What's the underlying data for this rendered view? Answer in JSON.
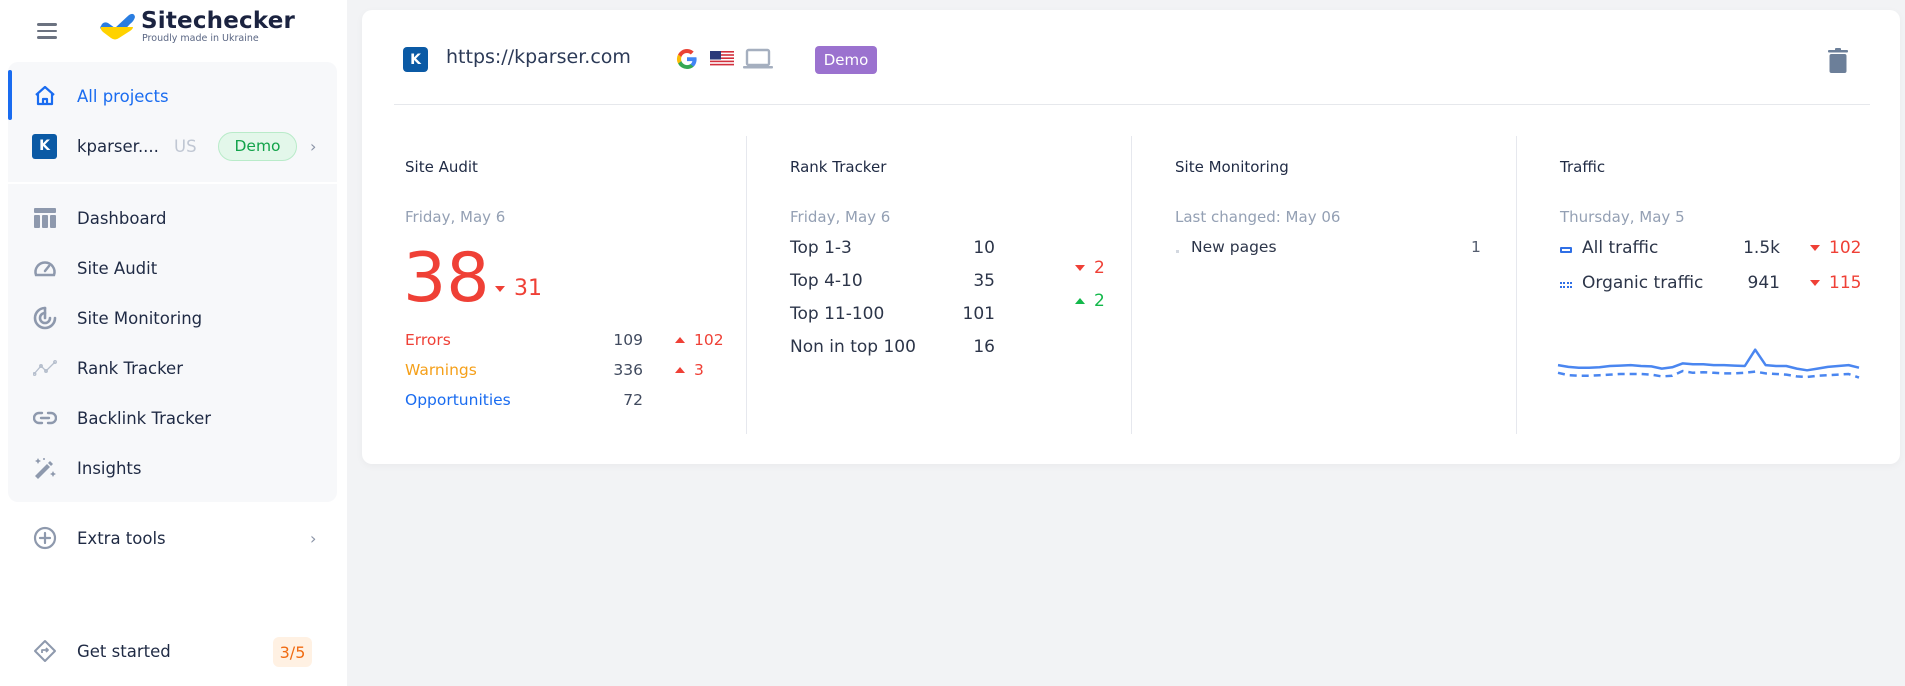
{
  "brand": {
    "name": "Sitechecker",
    "tagline": "Proudly made in Ukraine"
  },
  "sidebar": {
    "all_projects": "All projects",
    "project": {
      "initial": "K",
      "name": "kparser....",
      "country": "US",
      "badge": "Demo"
    },
    "items": [
      {
        "label": "Dashboard",
        "icon": "dashboard-icon"
      },
      {
        "label": "Site Audit",
        "icon": "gauge-icon"
      },
      {
        "label": "Site Monitoring",
        "icon": "radar-icon"
      },
      {
        "label": "Rank Tracker",
        "icon": "trend-line-icon"
      },
      {
        "label": "Backlink Tracker",
        "icon": "link-icon"
      },
      {
        "label": "Insights",
        "icon": "magic-wand-icon"
      }
    ],
    "extra_tools": "Extra tools",
    "get_started": {
      "label": "Get started",
      "progress": "3/5"
    }
  },
  "project_card": {
    "initial": "K",
    "url": "https://kparser.com",
    "search_engine": "Google",
    "country": "US",
    "device": "desktop",
    "badge": "Demo",
    "site_audit": {
      "title": "Site Audit",
      "date": "Friday, May 6",
      "score": "38",
      "score_delta": "31",
      "score_delta_dir": "down",
      "rows": [
        {
          "label": "Errors",
          "value": "109",
          "delta": "102",
          "dir": "up"
        },
        {
          "label": "Warnings",
          "value": "336",
          "delta": "3",
          "dir": "up"
        },
        {
          "label": "Opportunities",
          "value": "72",
          "delta": "",
          "dir": ""
        }
      ]
    },
    "rank_tracker": {
      "title": "Rank Tracker",
      "date": "Friday, May 6",
      "rows": [
        {
          "label": "Top 1-3",
          "value": "10",
          "delta": "2",
          "dir": "down"
        },
        {
          "label": "Top 4-10",
          "value": "35",
          "delta": "2",
          "dir": "up"
        },
        {
          "label": "Top 11-100",
          "value": "101",
          "delta": "",
          "dir": ""
        },
        {
          "label": "Non in top 100",
          "value": "16",
          "delta": "",
          "dir": ""
        }
      ]
    },
    "site_monitoring": {
      "title": "Site Monitoring",
      "date": "Last changed: May 06",
      "rows": [
        {
          "label": "New pages",
          "value": "1"
        }
      ]
    },
    "traffic": {
      "title": "Traffic",
      "date": "Thursday, May 5",
      "rows": [
        {
          "label": "All traffic",
          "value": "1.5k",
          "delta": "102",
          "dir": "down"
        },
        {
          "label": "Organic traffic",
          "value": "941",
          "delta": "115",
          "dir": "down"
        }
      ],
      "sparkline": {
        "all_traffic": [
          1520,
          1500,
          1490,
          1490,
          1495,
          1510,
          1515,
          1520,
          1510,
          1505,
          1480,
          1495,
          1540,
          1530,
          1530,
          1520,
          1520,
          1515,
          1510,
          1700,
          1520,
          1510,
          1510,
          1480,
          1460,
          1480,
          1500,
          1510,
          1520,
          1490
        ],
        "organic_traffic": [
          960,
          940,
          935,
          935,
          940,
          945,
          950,
          950,
          950,
          945,
          930,
          935,
          975,
          960,
          965,
          960,
          955,
          955,
          960,
          970,
          955,
          950,
          945,
          930,
          925,
          935,
          940,
          945,
          950,
          920
        ]
      }
    }
  },
  "colors": {
    "accent": "#1a6cf0",
    "negative": "#ef4036",
    "positive": "#12b84a",
    "warning": "#f5a01a",
    "demo_badge": "#9b72cf",
    "demo_pill_text": "#12a34a",
    "get_started_badge": "#f06b12"
  }
}
